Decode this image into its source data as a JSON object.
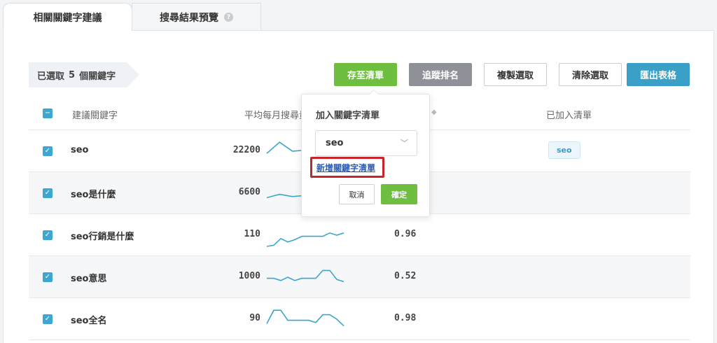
{
  "tabs": [
    {
      "label": "相關關鍵字建議",
      "active": true
    },
    {
      "label": "搜尋結果預覽",
      "active": false
    }
  ],
  "toolbar": {
    "selected_prefix": "已選取",
    "selected_count": "5",
    "selected_suffix": "個關鍵字",
    "save_list": "存至清單",
    "track_rank": "追蹤排名",
    "copy_selected": "複製選取",
    "clear_selected": "清除選取",
    "export_sheet": "匯出表格"
  },
  "table": {
    "headers": {
      "keyword": "建議關鍵字",
      "volume": "平均每月搜尋量",
      "lists": "已加入清單"
    },
    "rows": [
      {
        "keyword": "seo",
        "volume": "22200",
        "competition": "",
        "list": "seo",
        "trend": [
          0.4,
          0.9,
          0.5,
          0.55,
          0.55,
          0.55,
          0.55
        ]
      },
      {
        "keyword": "seo是什麼",
        "volume": "6600",
        "competition": "",
        "list": "",
        "trend": [
          0.3,
          0.45,
          0.35,
          0.4,
          0.45,
          0.4,
          0.45
        ]
      },
      {
        "keyword": "seo行銷是什麼",
        "volume": "110",
        "competition": "0.96",
        "list": "",
        "trend": [
          0.0,
          0.05,
          0.35,
          0.2,
          0.3,
          0.45,
          0.45,
          0.45,
          0.45,
          0.6,
          0.5,
          0.6
        ]
      },
      {
        "keyword": "seo意思",
        "volume": "1000",
        "competition": "0.52",
        "list": "",
        "trend": [
          0.45,
          0.45,
          0.35,
          0.5,
          0.35,
          0.45,
          0.45,
          0.45,
          0.8,
          0.8,
          0.4,
          0.3
        ]
      },
      {
        "keyword": "seo全名",
        "volume": "90",
        "competition": "0.98",
        "list": "",
        "trend": [
          0.3,
          0.9,
          0.9,
          0.45,
          0.45,
          0.45,
          0.45,
          0.35,
          0.7,
          0.7,
          0.5,
          0.2
        ]
      }
    ]
  },
  "popover": {
    "title": "加入關鍵字清單",
    "selected_list": "seo",
    "new_list_link": "新增關鍵字清單",
    "cancel": "取消",
    "confirm": "確定"
  },
  "colors": {
    "accent_green": "#6ebf3f",
    "accent_blue": "#3aa0c8",
    "checkbox_blue": "#3da7d2",
    "sparkline": "#3ba6cc",
    "highlight_red": "#c8242a"
  }
}
